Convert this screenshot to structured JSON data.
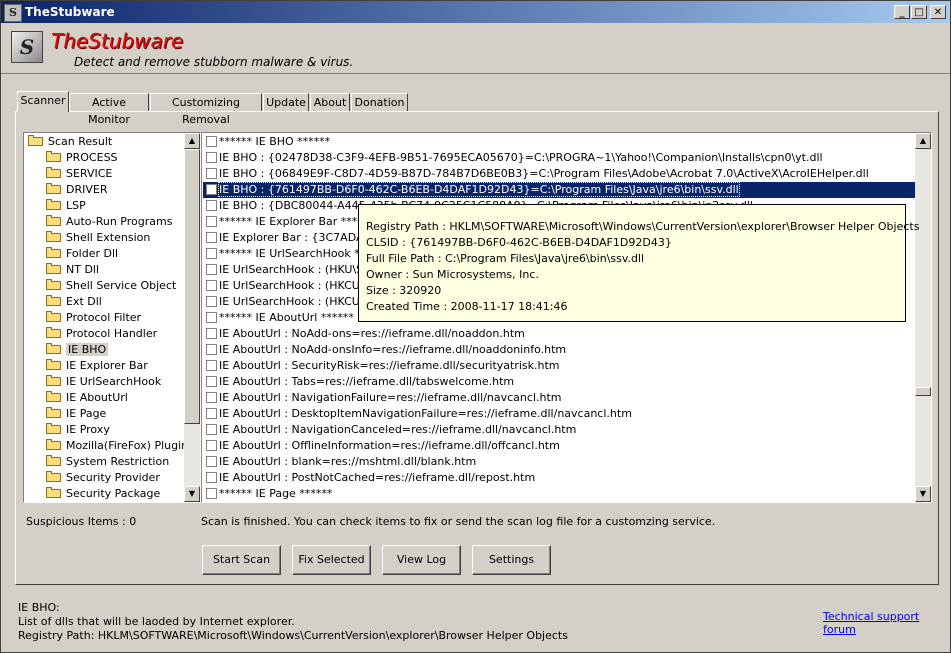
{
  "window": {
    "title": "TheStubware",
    "icon_letter": "S"
  },
  "header": {
    "app_name": "TheStubware",
    "tagline": "Detect and remove stubborn malware & virus.",
    "logo_letter": "S"
  },
  "tabs": [
    "Scanner",
    "Active Monitor",
    "Customizing Removal",
    "Update",
    "About",
    "Donation"
  ],
  "active_tab": "Scanner",
  "tree": {
    "root": "Scan Result",
    "items": [
      "PROCESS",
      "SERVICE",
      "DRIVER",
      "LSP",
      "Auto-Run Programs",
      "Shell Extension",
      "Folder Dll",
      "NT Dll",
      "Shell Service Object",
      "Ext Dll",
      "Protocol Filter",
      "Protocol Handler",
      "IE BHO",
      "IE Explorer Bar",
      "IE UrlSearchHook",
      "IE AboutUrl",
      "IE Page",
      "IE Proxy",
      "Mozilla(FireFox) Plugin",
      "System Restriction",
      "Security Provider",
      "Security Package"
    ],
    "selected": "IE BHO"
  },
  "results": [
    "****** IE BHO ******",
    "IE BHO : {02478D38-C3F9-4EFB-9B51-7695ECA05670}=C:\\PROGRA~1\\Yahoo!\\Companion\\Installs\\cpn0\\yt.dll",
    "IE BHO : {06849E9F-C8D7-4D59-B87D-784B7D6BE0B3}=C:\\Program Files\\Adobe\\Acrobat 7.0\\ActiveX\\AcroIEHelper.dll",
    "IE BHO : {761497BB-D6F0-462C-B6EB-D4DAF1D92D43}=C:\\Program Files\\Java\\jre6\\bin\\ssv.dll",
    "IE BHO : {DBC80044-A445-435b-BC74-9C25C1C588A9}=C:\\Program Files\\Java\\jre6\\bin\\jp2ssv.dll",
    "****** IE Explorer Bar ******",
    "IE Explorer Bar : {3C7ADADE",
    "****** IE UrlSearchHook ******",
    "IE UrlSearchHook : (HKU\\S-1-",
    "IE UrlSearchHook : (HKCU)\\{C",
    "IE UrlSearchHook : (HKCU)\\{E",
    "****** IE AboutUrl ******",
    "IE AboutUrl : NoAdd-ons=res://ieframe.dll/noaddon.htm",
    "IE AboutUrl : NoAdd-onsInfo=res://ieframe.dll/noaddoninfo.htm",
    "IE AboutUrl : SecurityRisk=res://ieframe.dll/securityatrisk.htm",
    "IE AboutUrl : Tabs=res://ieframe.dll/tabswelcome.htm",
    "IE AboutUrl : NavigationFailure=res://ieframe.dll/navcancl.htm",
    "IE AboutUrl : DesktopItemNavigationFailure=res://ieframe.dll/navcancl.htm",
    "IE AboutUrl : NavigationCanceled=res://ieframe.dll/navcancl.htm",
    "IE AboutUrl : OfflineInformation=res://ieframe.dll/offcancl.htm",
    "IE AboutUrl : blank=res://mshtml.dll/blank.htm",
    "IE AboutUrl : PostNotCached=res://ieframe.dll/repost.htm",
    "****** IE Page ******"
  ],
  "selected_result_index": 3,
  "tooltip": {
    "registry_path": "Registry Path : HKLM\\SOFTWARE\\Microsoft\\Windows\\CurrentVersion\\explorer\\Browser Helper Objects",
    "clsid": "CLSID : {761497BB-D6F0-462C-B6EB-D4DAF1D92D43}",
    "file_path": "Full File Path : C:\\Program Files\\Java\\jre6\\bin\\ssv.dll",
    "owner": "Owner : Sun Microsystems, Inc.",
    "size": "Size : 320920",
    "created": "Created Time : 2008-11-17 18:41:46"
  },
  "suspicious_items": "Suspicious Items :  0",
  "status_text": "Scan is finished. You can check items to fix or send the scan log file for a customzing service.",
  "buttons": {
    "start_scan": "Start Scan",
    "fix_selected": "Fix Selected",
    "view_log": "View Log",
    "settings": "Settings"
  },
  "description": {
    "title": "IE BHO:",
    "line1": "List of dlls that will be laoded by Internet explorer.",
    "line2": "Registry Path: HKLM\\SOFTWARE\\Microsoft\\Windows\\CurrentVersion\\explorer\\Browser Helper Objects"
  },
  "support_link": "Technical support forum",
  "titlebar_buttons": {
    "minimize": "_",
    "maximize": "□",
    "close": "✕"
  }
}
